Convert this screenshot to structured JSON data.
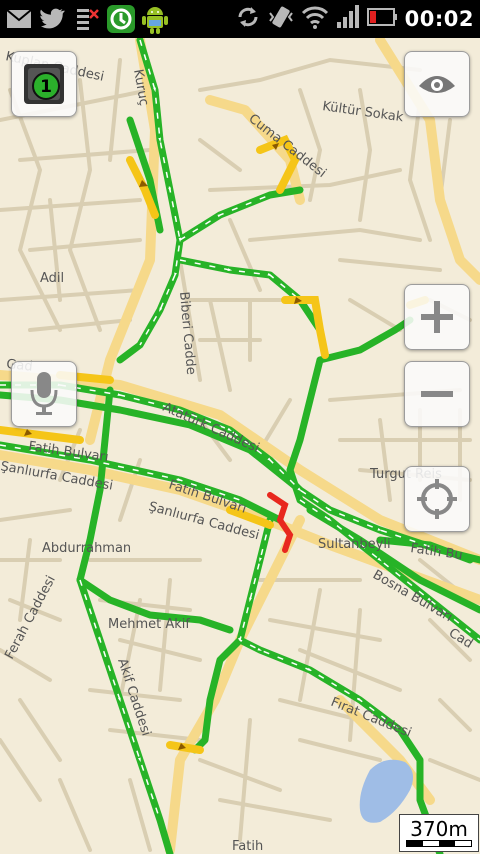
{
  "status_bar": {
    "left_icons": [
      "gmail-icon",
      "twitter-icon",
      "usb-debug-icon",
      "traffic-app-icon",
      "android-icon"
    ],
    "right_icons": [
      "sync-icon",
      "vibrate-icon",
      "wifi-icon",
      "signal-icon",
      "battery-icon"
    ],
    "time": "00:02"
  },
  "map": {
    "layer_badge": "1",
    "labels": {
      "kuplan": "Kuplan Caddesi",
      "kultur": "Kültür Sokak",
      "cuma": "Cuma Caddesi",
      "adil": "Adil",
      "biberi": "Biberi Cadde",
      "ataturk": "Atatürk Caddesi",
      "fatih_bulvari_w": "Fatih Bulvarı",
      "sanliurfa_w": "Şanlıurfa Caddesi",
      "fatih_bulvari_c": "Fatih Bulvarı",
      "sanliurfa_c": "Şanlıurfa Caddesi",
      "turgut": "Turgut Reis",
      "sultanbeyli": "Sultanbeyli",
      "fatih_e": "Fatih Bu",
      "bosna": "Bosna Bulvarı",
      "abdurrahman": "Abdurrahman",
      "mehmet_akif": "Mehmet Akif",
      "ferah": "Ferah Caddesi",
      "akif": "Akif Caddesi",
      "firat": "Fırat Caddesi",
      "fatih_s": "Fatih",
      "gad": "Gad",
      "cad": "Cad",
      "kuruc": "Kuruç"
    },
    "scale": "370m"
  },
  "controls": {
    "layers": "layers-button",
    "view": "eye-icon",
    "zoom_in": "plus-icon",
    "zoom_out": "minus-icon",
    "voice": "microphone-icon",
    "locate": "locate-icon"
  },
  "colors": {
    "map_bg": "#f3ecd9",
    "street": "#ffffff",
    "street_outline": "#d9ceb2",
    "main_road": "#f6d98a",
    "traffic_green": "#27b327",
    "traffic_yellow": "#f5c518",
    "traffic_red": "#e8281e",
    "water": "#9fbde6"
  }
}
